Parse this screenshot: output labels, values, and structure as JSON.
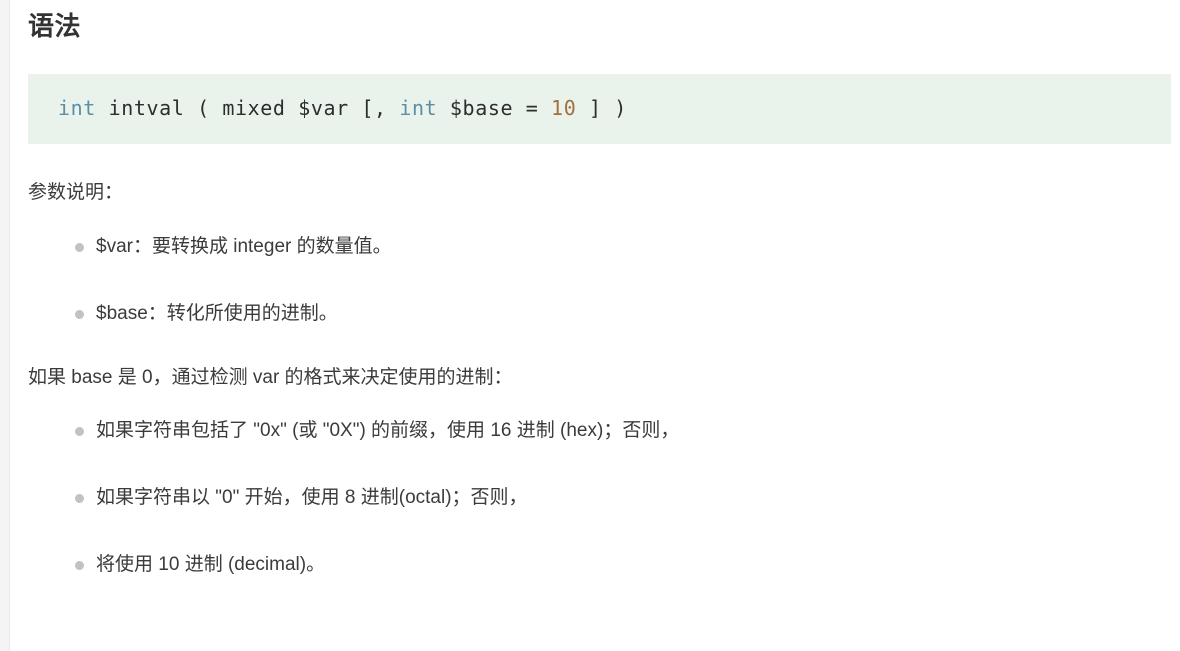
{
  "page": {
    "title": "语法",
    "background_color": "#ffffff",
    "text_color": "#3b3b3b",
    "gutter_color": "#f4f4f5"
  },
  "code_block": {
    "background_color": "#e9f3ec",
    "language": "php",
    "full_text": "int intval ( mixed $var [, int $base = 10 ] )",
    "tokens": [
      {
        "text": "int",
        "kind": "type",
        "color": "#5b8fa8"
      },
      {
        "text": " intval ( mixed $var [, ",
        "kind": "plain",
        "color": "#2d2d2d"
      },
      {
        "text": "int",
        "kind": "type",
        "color": "#5b8fa8"
      },
      {
        "text": " $base = ",
        "kind": "plain",
        "color": "#2d2d2d"
      },
      {
        "text": "10",
        "kind": "number",
        "color": "#a0703f"
      },
      {
        "text": " ] )",
        "kind": "plain",
        "color": "#2d2d2d"
      }
    ]
  },
  "params_section": {
    "heading": "参数说明：",
    "items": [
      {
        "label": "$var：要转换成 integer 的数量值。"
      },
      {
        "label": "$base：转化所使用的进制。"
      }
    ]
  },
  "base_section": {
    "intro": "如果 base 是 0，通过检测 var 的格式来决定使用的进制：",
    "items": [
      {
        "label": "如果字符串包括了 \"0x\" (或 \"0X\") 的前缀，使用 16 进制 (hex)；否则，"
      },
      {
        "label": "如果字符串以 \"0\" 开始，使用 8 进制(octal)；否则，"
      },
      {
        "label": "将使用 10 进制 (decimal)。"
      }
    ]
  },
  "bullet": {
    "color": "#c2c2c2"
  }
}
